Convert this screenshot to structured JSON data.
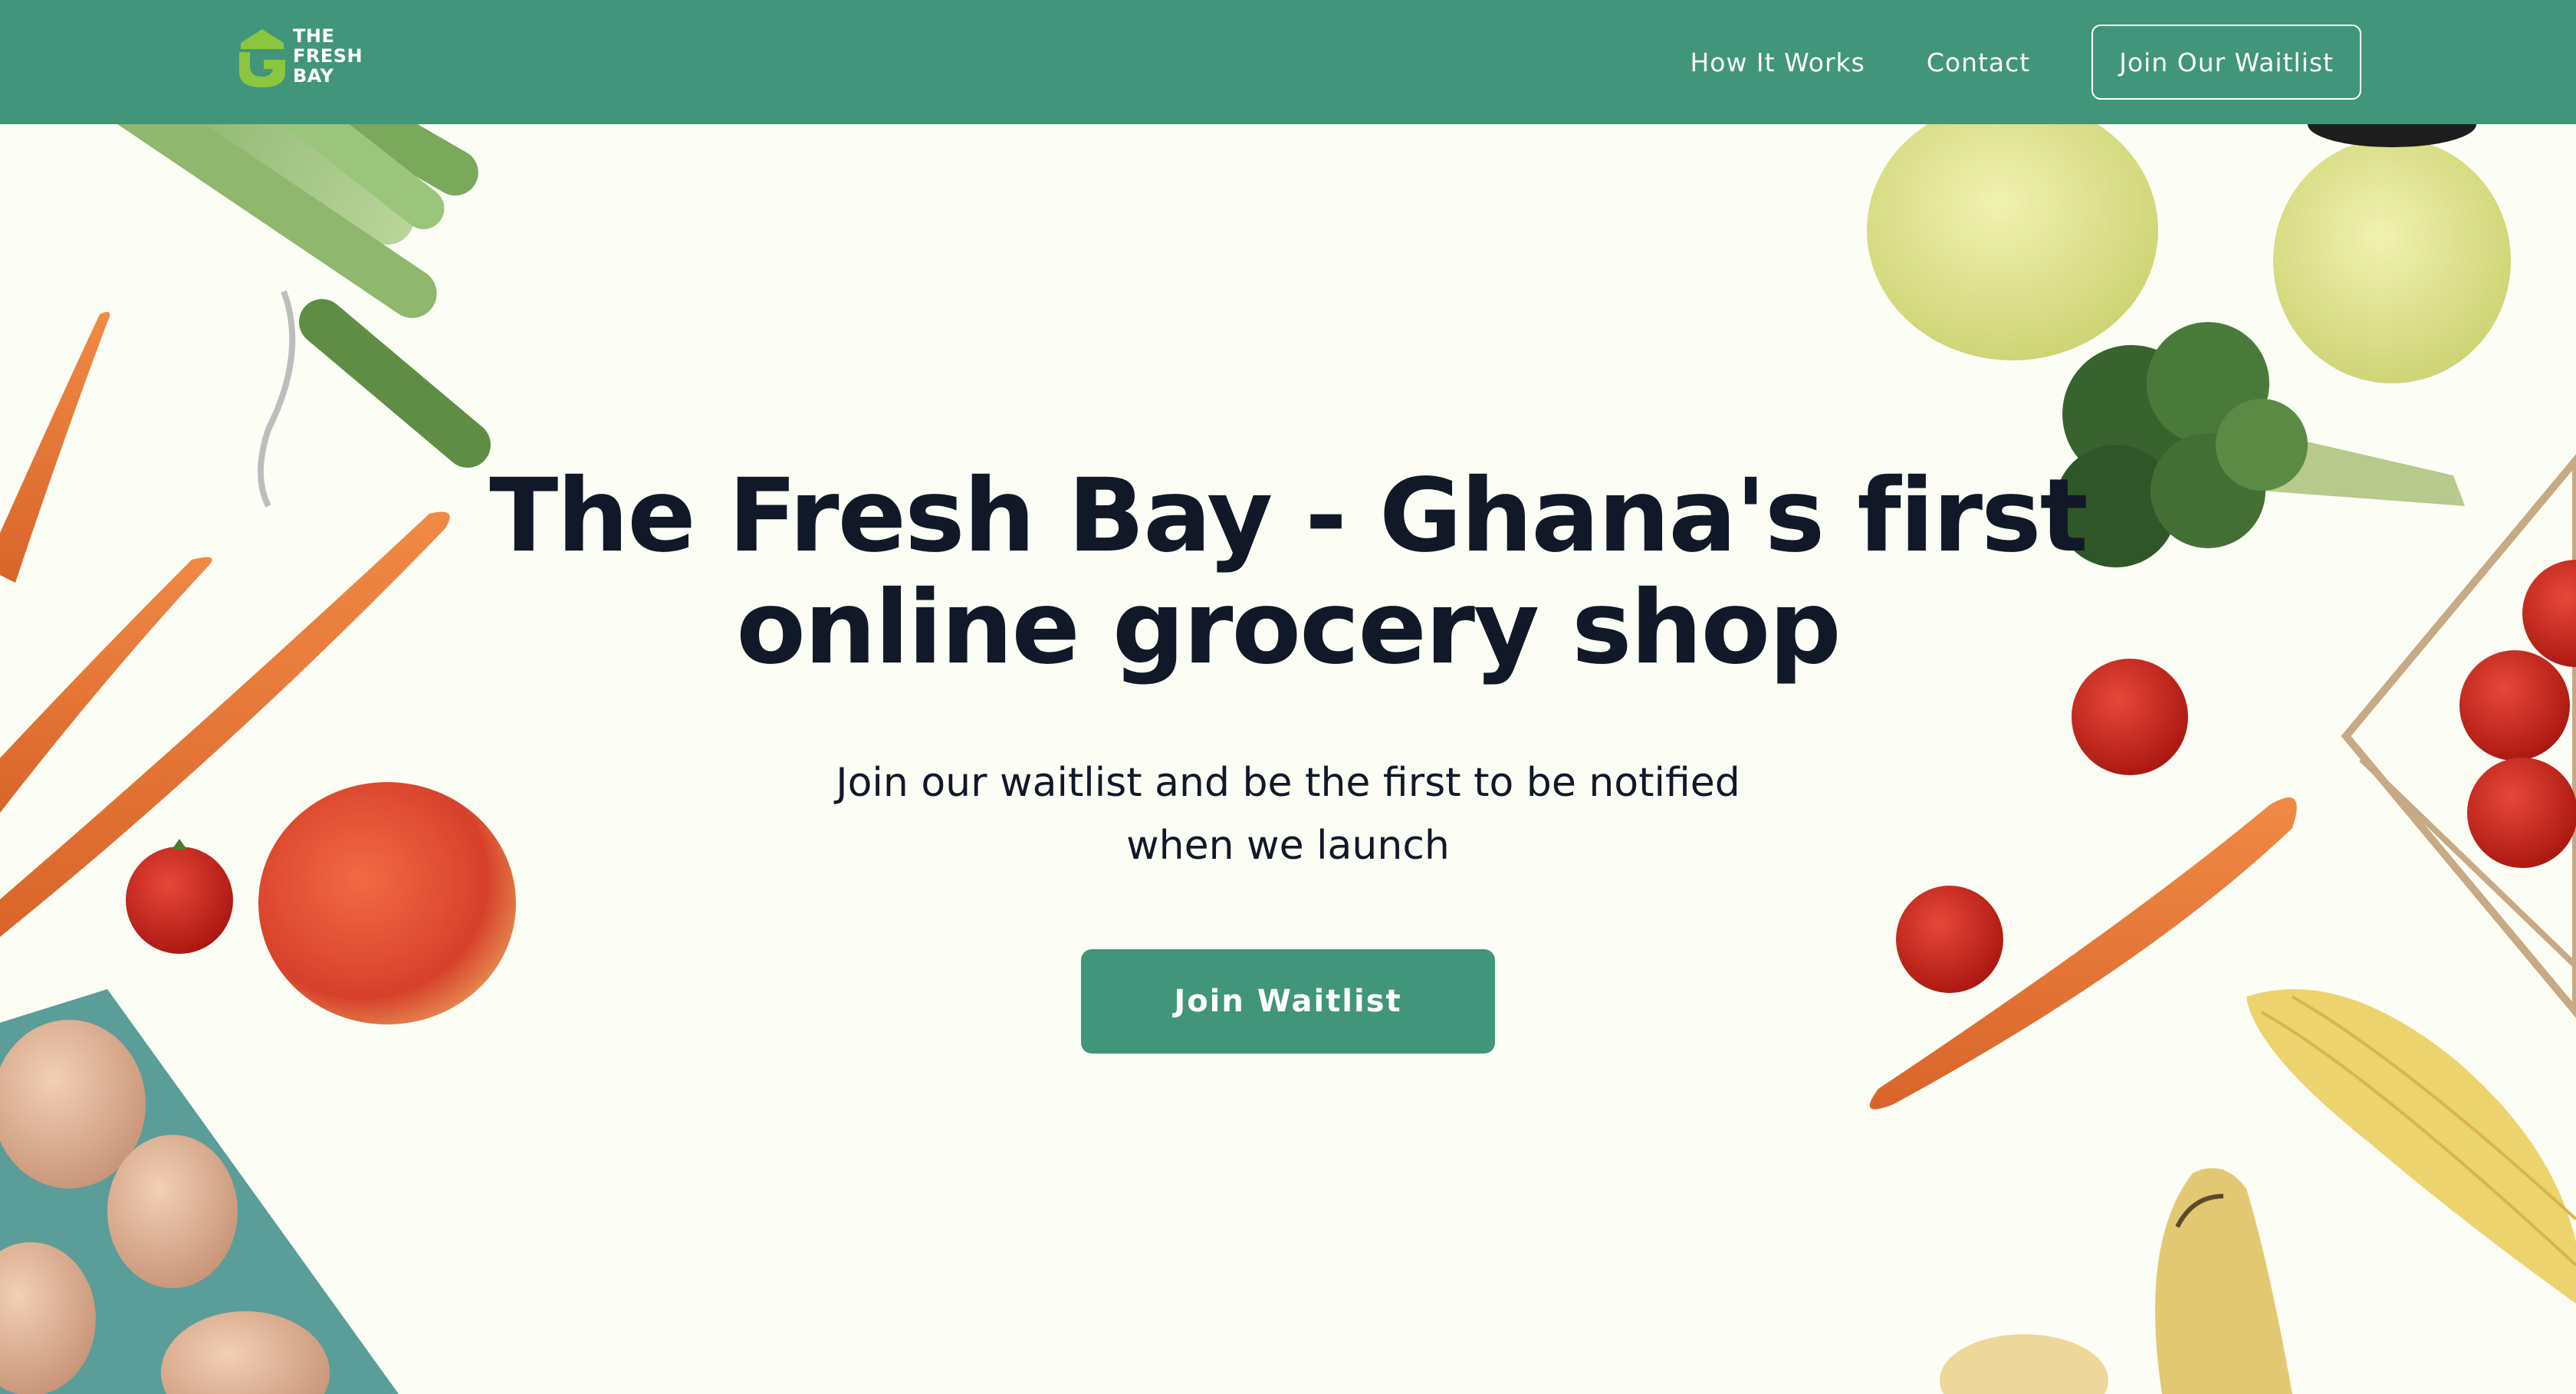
{
  "brand": {
    "logo_lines": [
      "THE",
      "FRESH",
      "BAY"
    ],
    "colors": {
      "primary": "#41957a",
      "logo_accent": "#8cc63f",
      "background": "#fcfef6",
      "text": "#111827"
    }
  },
  "nav": {
    "links": [
      "How It Works",
      "Contact"
    ],
    "cta_label": "Join Our Waitlist"
  },
  "hero": {
    "title_lines": [
      "The Fresh Bay - Ghana's first",
      "online grocery shop"
    ],
    "subtitle_lines": [
      "Join our waitlist and be the first to be notified",
      "when we launch"
    ],
    "button_label": "Join Waitlist"
  },
  "decorations": {
    "left": [
      "celery",
      "carrot",
      "carrot",
      "carrot",
      "tomato",
      "peach",
      "egg-tray"
    ],
    "right": [
      "apple",
      "apple",
      "broccoli",
      "tomato",
      "tomato-basket",
      "tomato",
      "carrot",
      "corn",
      "banana"
    ]
  }
}
